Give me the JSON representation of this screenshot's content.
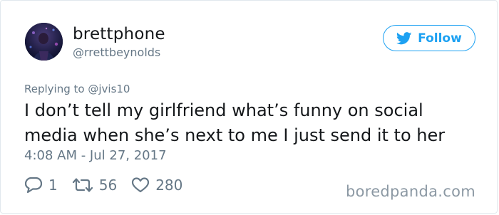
{
  "user": {
    "display_name": "brettphone",
    "handle": "@rrettbeynolds",
    "avatar_icon": "avatar-photo"
  },
  "follow_button": {
    "label": "Follow",
    "icon": "twitter-bird-icon",
    "color": "#1da1f2"
  },
  "tweet": {
    "replying_prefix": "Replying to",
    "replying_handle": "@jvis10",
    "text": "I don’t tell my girlfriend what’s funny on social media when she’s next to me I just send it to her",
    "timestamp": "4:08 AM - Jul 27, 2017"
  },
  "actions": {
    "reply_count": "1",
    "retweet_count": "56",
    "like_count": "280"
  },
  "watermark": "boredpanda.com",
  "colors": {
    "text": "#14171a",
    "secondary": "#657786",
    "accent": "#1da1f2",
    "border": "#e1e8ed"
  }
}
